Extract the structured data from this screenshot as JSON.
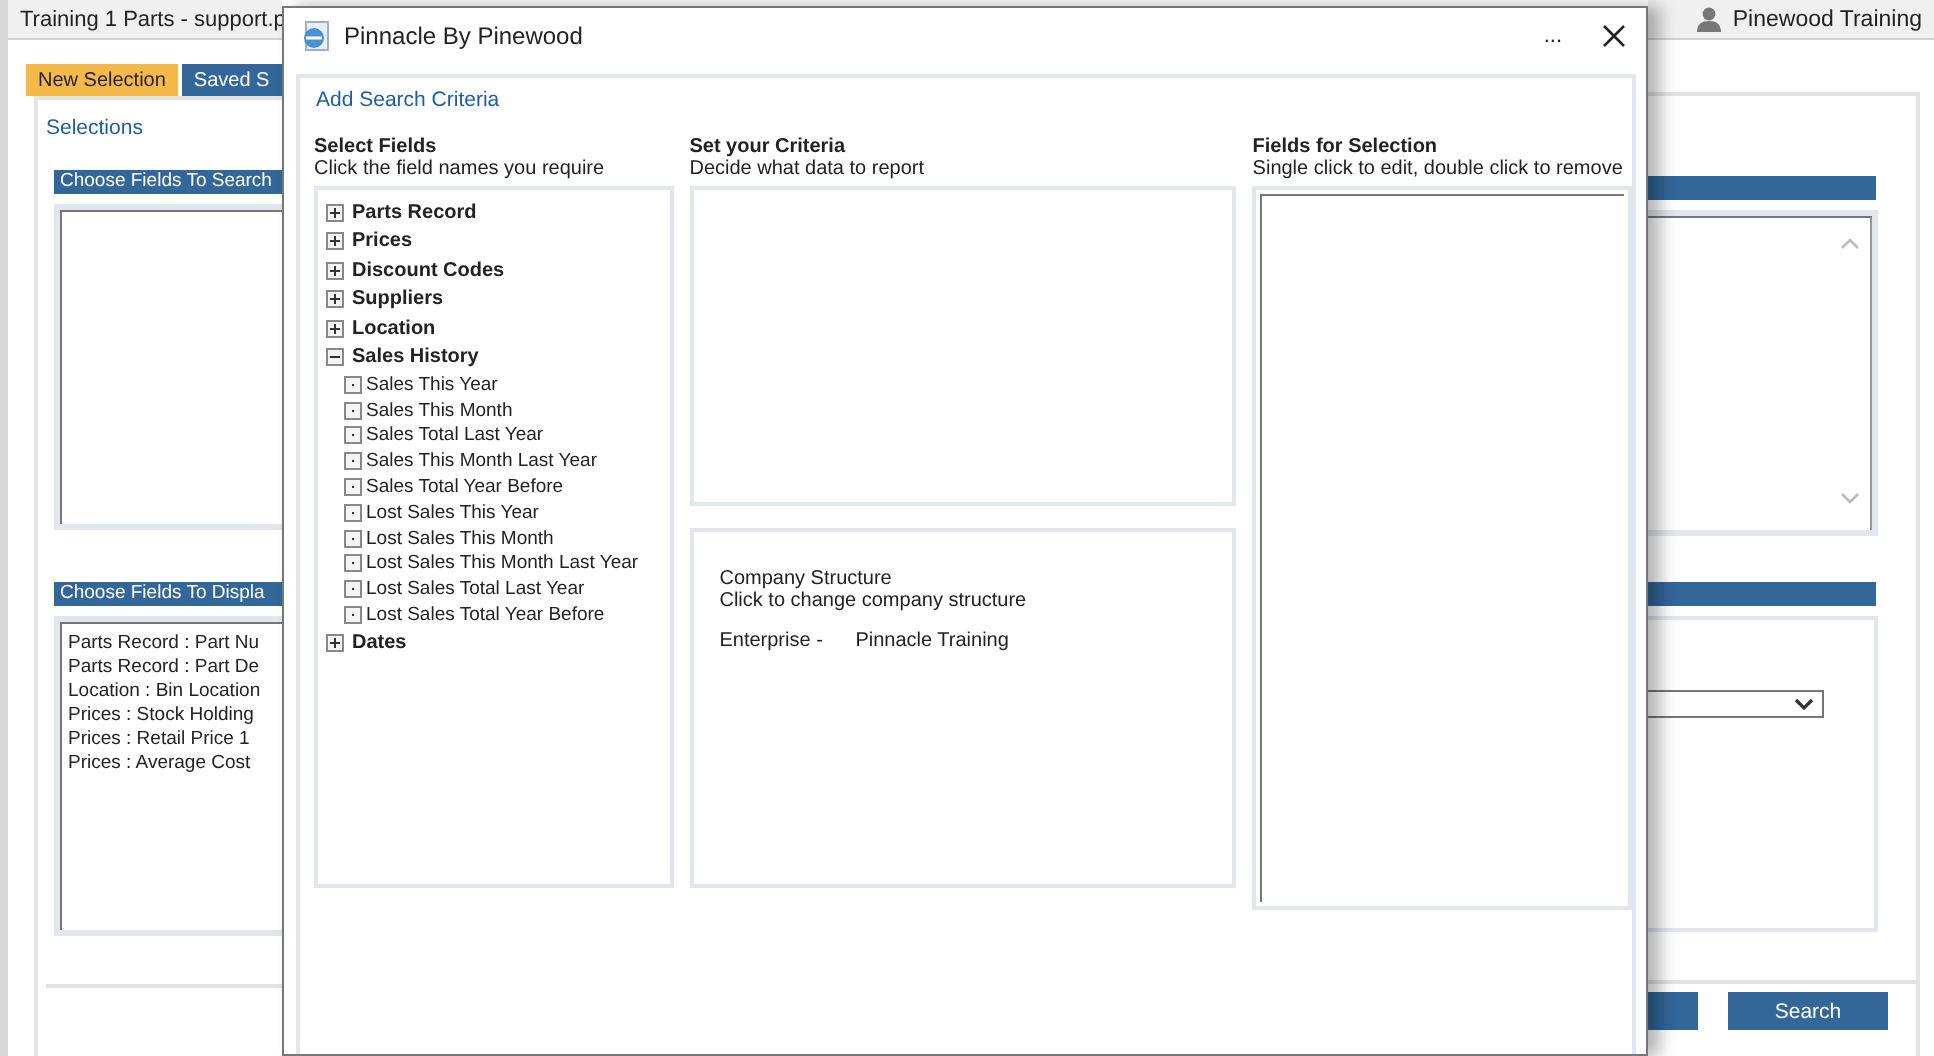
{
  "app": {
    "title": "Training 1 Parts - support.p",
    "user": "Pinewood Training"
  },
  "tabs": [
    {
      "label": "New Selection",
      "selected": true
    },
    {
      "label": "Saved S",
      "selected": false
    }
  ],
  "selections_link": "Selections",
  "search_panel": {
    "title": "Choose Fields To Search"
  },
  "display_panel": {
    "title": "Choose Fields To Displa",
    "items": [
      "Parts Record : Part Nu",
      "Parts Record : Part De",
      "Location : Bin Location",
      "Prices : Stock Holding",
      "Prices : Retail Price 1",
      "Prices : Average Cost"
    ]
  },
  "search_button": "Search",
  "dialog": {
    "title": "Pinnacle By Pinewood",
    "more": "...",
    "link": "Add Search Criteria",
    "select_fields": {
      "heading": "Select Fields",
      "hint": "Click the field names you require",
      "tree": [
        {
          "label": "Parts Record",
          "expanded": false
        },
        {
          "label": "Prices",
          "expanded": false
        },
        {
          "label": "Discount Codes",
          "expanded": false
        },
        {
          "label": "Suppliers",
          "expanded": false
        },
        {
          "label": "Location",
          "expanded": false
        },
        {
          "label": "Sales History",
          "expanded": true,
          "children": [
            "Sales This Year",
            "Sales This Month",
            "Sales Total Last Year",
            "Sales This Month Last Year",
            "Sales Total Year Before",
            "Lost Sales This Year",
            "Lost Sales This Month",
            "Lost Sales This Month Last Year",
            "Lost Sales Total Last Year",
            "Lost Sales Total Year Before"
          ]
        },
        {
          "label": "Dates",
          "expanded": false
        }
      ]
    },
    "criteria": {
      "heading": "Set your Criteria",
      "hint": "Decide what data to report"
    },
    "company": {
      "title": "Company Structure",
      "hint": "Click to change company structure",
      "label": "Enterprise -",
      "value": "Pinnacle Training"
    },
    "fields_for_selection": {
      "heading": "Fields for Selection",
      "hint": "Single click to edit, double click to remove"
    }
  }
}
